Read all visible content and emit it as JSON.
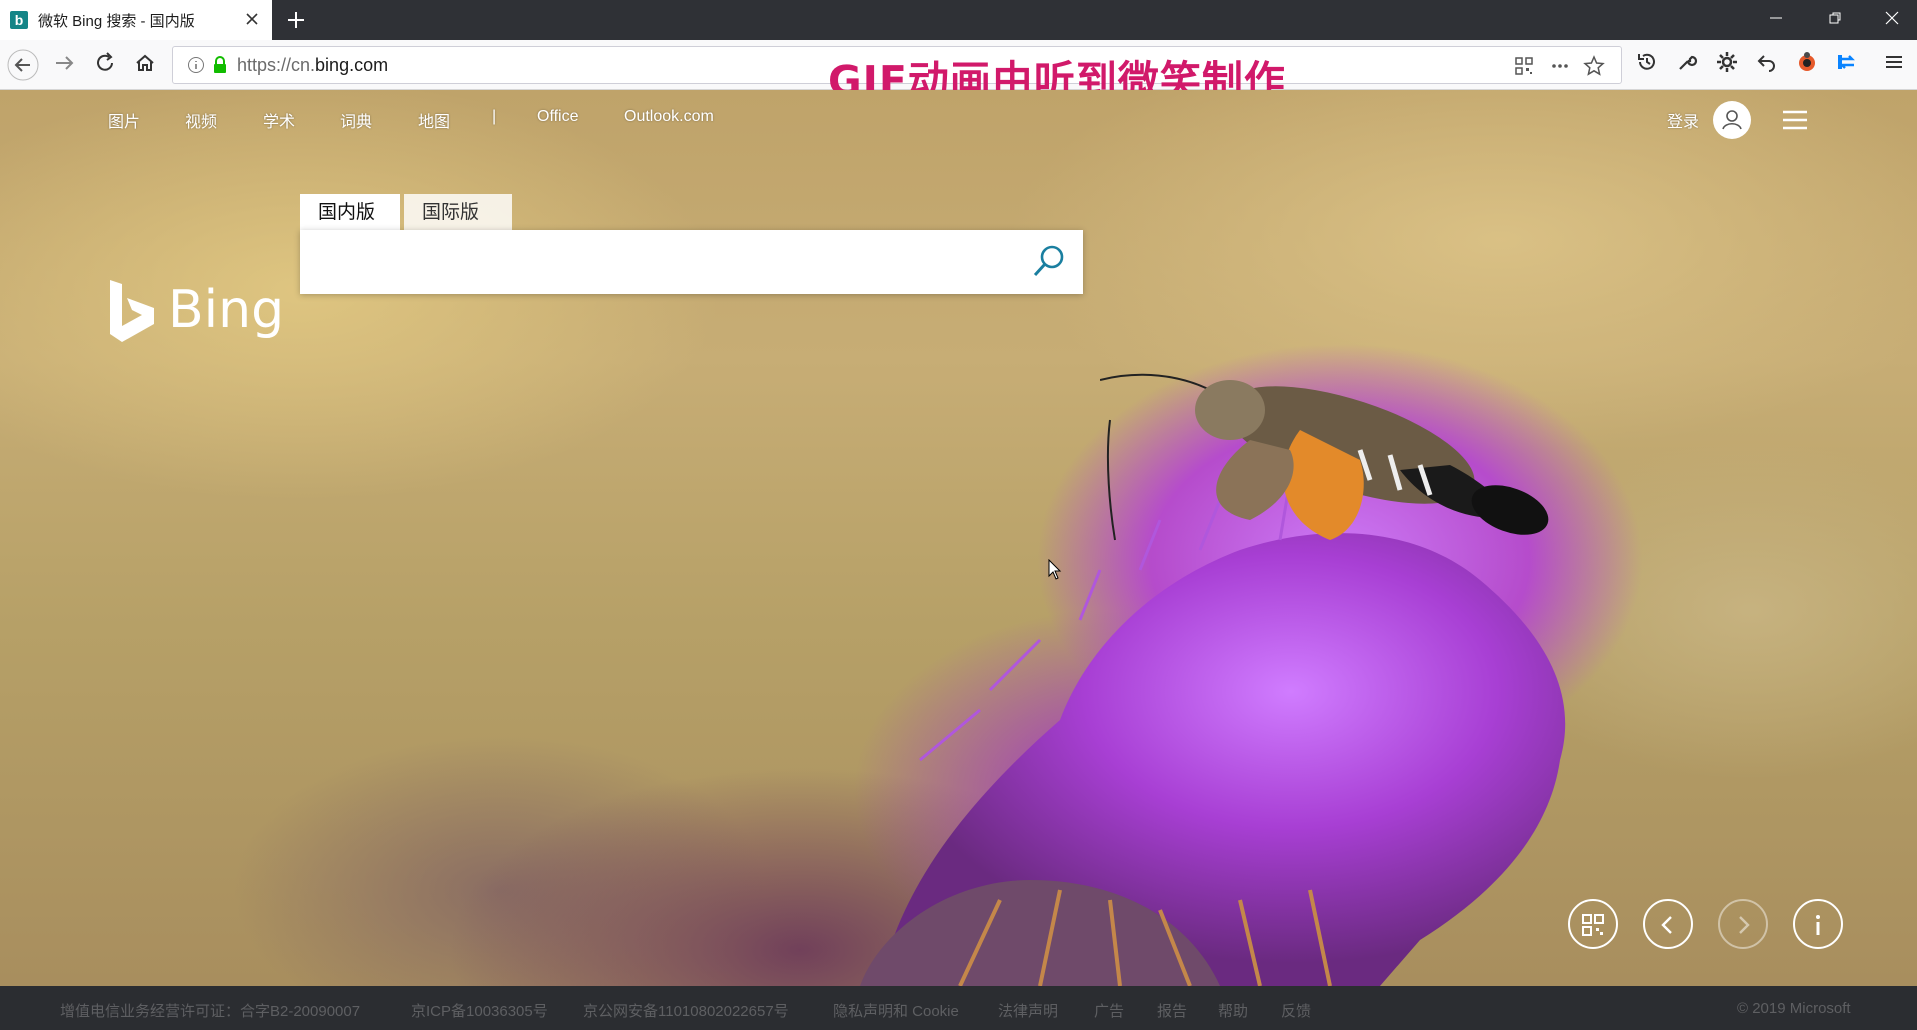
{
  "browser": {
    "tab_title": "微软 Bing 搜索 - 国内版",
    "url_prefix": "https://cn.",
    "url_domain": "bing.com",
    "gif_caption": "GIF动画由听到微笑制作"
  },
  "top_nav": {
    "links": [
      "图片",
      "视频",
      "学术",
      "词典",
      "地图",
      "|",
      "Office",
      "Outlook.com"
    ],
    "login_label": "登录"
  },
  "logo": {
    "text": "Bing"
  },
  "search": {
    "tabs": [
      "国内版",
      "国际版"
    ],
    "active_tab": "国内版",
    "query": ""
  },
  "footer": {
    "links": [
      "增值电信业务经营许可证：合字B2-20090007",
      "京ICP备10036305号",
      "京公网安备11010802022657号",
      "隐私声明和 Cookie",
      "法律声明",
      "广告",
      "报告",
      "帮助",
      "反馈"
    ],
    "copyright": "© 2019 Microsoft"
  },
  "colors": {
    "accent": "#148587",
    "caption": "#d1196a",
    "flower": "#b84ae0"
  }
}
